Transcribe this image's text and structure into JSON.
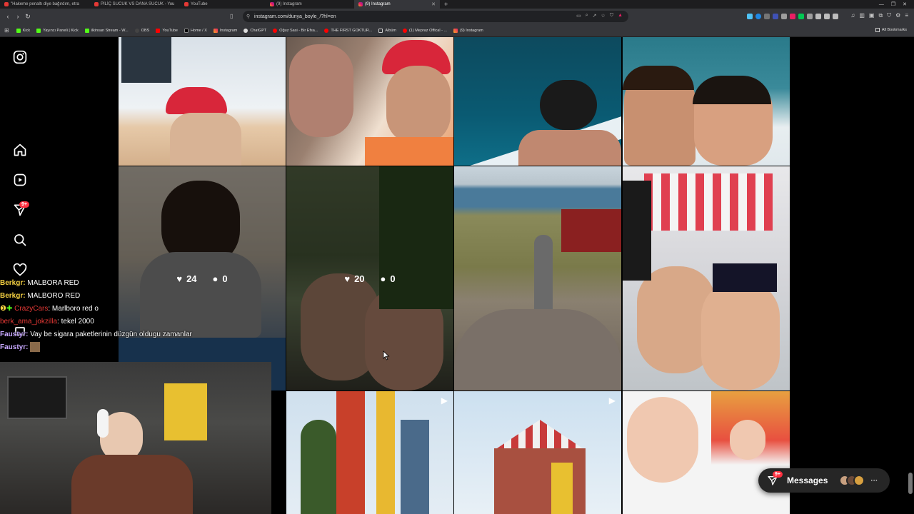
{
  "browser": {
    "tabs": [
      {
        "title": "\"Hakeme penaltı diye bağırdım, etra",
        "icon": "youtube-icon",
        "active": false
      },
      {
        "title": "PİLİÇ SUCUK VS DANA SUCUK - You",
        "icon": "youtube-icon",
        "active": false
      },
      {
        "title": "YouTube",
        "icon": "youtube-icon",
        "active": false
      },
      {
        "title": "(9) Instagram",
        "icon": "instagram-icon",
        "active": false
      },
      {
        "title": "(9) Instagram",
        "icon": "instagram-icon",
        "active": true
      }
    ],
    "url": "instagram.com/dunya_boyle_/?hl=en",
    "bookmarks": [
      {
        "label": "Kick"
      },
      {
        "label": "Yayıncı Paneli | Kick"
      },
      {
        "label": "ilkinsan Stream - W..."
      },
      {
        "label": "OBS"
      },
      {
        "label": "YouTube"
      },
      {
        "label": "Home / X"
      },
      {
        "label": "Instagram"
      },
      {
        "label": "ChatGPT"
      },
      {
        "label": "Oğuz Sasi - Bir Efsa..."
      },
      {
        "label": "THE FIRST GOKTUR..."
      },
      {
        "label": "Albüm"
      },
      {
        "label": "(1) Mepraz Offical - ..."
      },
      {
        "label": "(9) Instagram"
      }
    ],
    "all_bookmarks": "All Bookmarks"
  },
  "sidebar": {
    "notification_badge": "9+"
  },
  "posts": [
    {
      "likes": "24",
      "comments": "0"
    },
    {
      "likes": "20",
      "comments": "0"
    }
  ],
  "chat": [
    {
      "user": "Berkgr:",
      "message": "MALBORA RED",
      "color": "#f5d142"
    },
    {
      "user": "Berkgr:",
      "message": "MALBORO RED",
      "color": "#f5d142"
    },
    {
      "user": "CrazyCars",
      "message": ": Marlboro red o",
      "color": "#e53935"
    },
    {
      "user": "berk_ama_jokzilla",
      "message": ": tekel 2000",
      "color": "#e53935"
    },
    {
      "user": "Faustyr:",
      "message": "Vay be sigara paketlerinin düzgün oldugu zamanlar",
      "color": "#c7a8ff"
    },
    {
      "user": "Faustyr:",
      "message": "",
      "color": "#c7a8ff"
    }
  ],
  "messages_bar": {
    "label": "Messages",
    "badge": "9+"
  }
}
